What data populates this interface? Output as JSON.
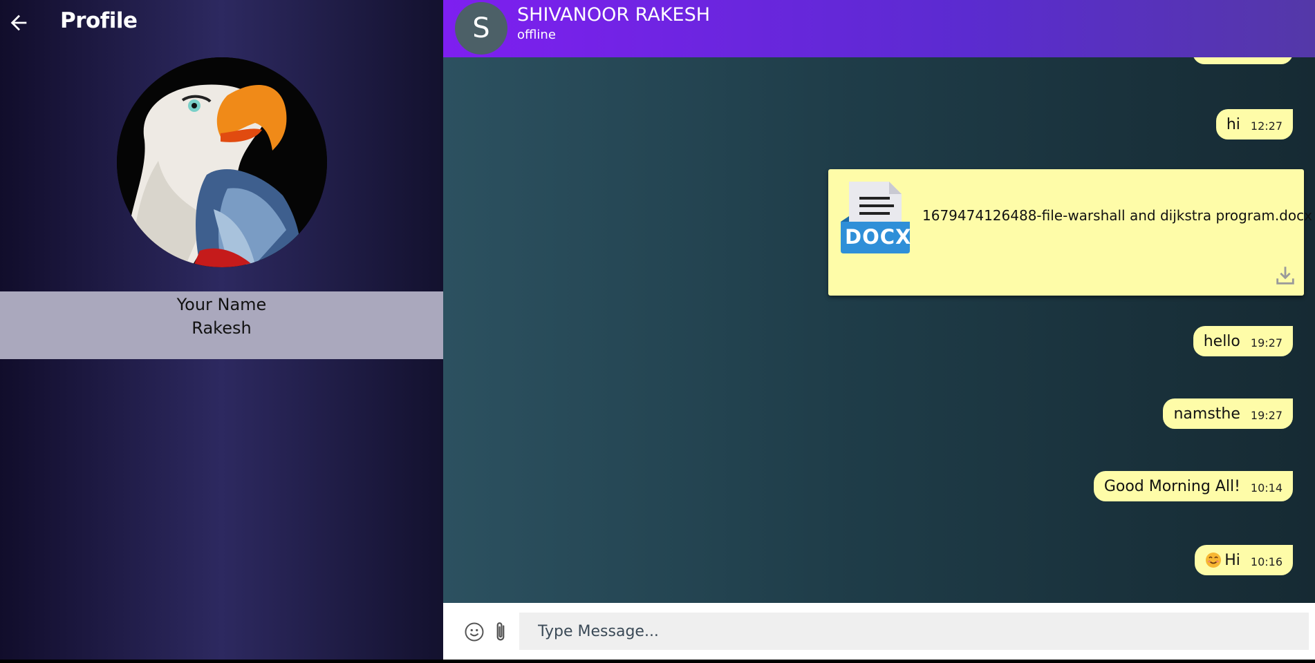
{
  "profile": {
    "title": "Profile",
    "back_icon": "arrow-left-icon",
    "name_label": "Your Name",
    "name_value": "Rakesh"
  },
  "chat": {
    "contact_initial": "S",
    "contact_name": "SHIVANOOR RAKESH",
    "contact_status": "offline",
    "messages": [
      {
        "text": "hi",
        "time": "12:27"
      },
      {
        "file_name": "1679474126488-file-warshall and dijkstra program.docx",
        "file_type": "DOCX",
        "icon": "docx-file-icon",
        "action_icon": "download-icon"
      },
      {
        "text": "hello",
        "time": "19:27"
      },
      {
        "text": "namsthe",
        "time": "19:27"
      },
      {
        "text": "Good Morning All!",
        "time": "10:14"
      },
      {
        "text": "Hi",
        "time": "10:16",
        "emoji": "smiling-face-emoji"
      }
    ],
    "composer": {
      "placeholder": "Type Message...",
      "emoji_icon": "emoji-icon",
      "attach_icon": "paperclip-icon"
    }
  },
  "colors": {
    "bubble": "#fefca8",
    "header_accent": "#7e1ff0",
    "name_box": "#aaa8bd"
  }
}
